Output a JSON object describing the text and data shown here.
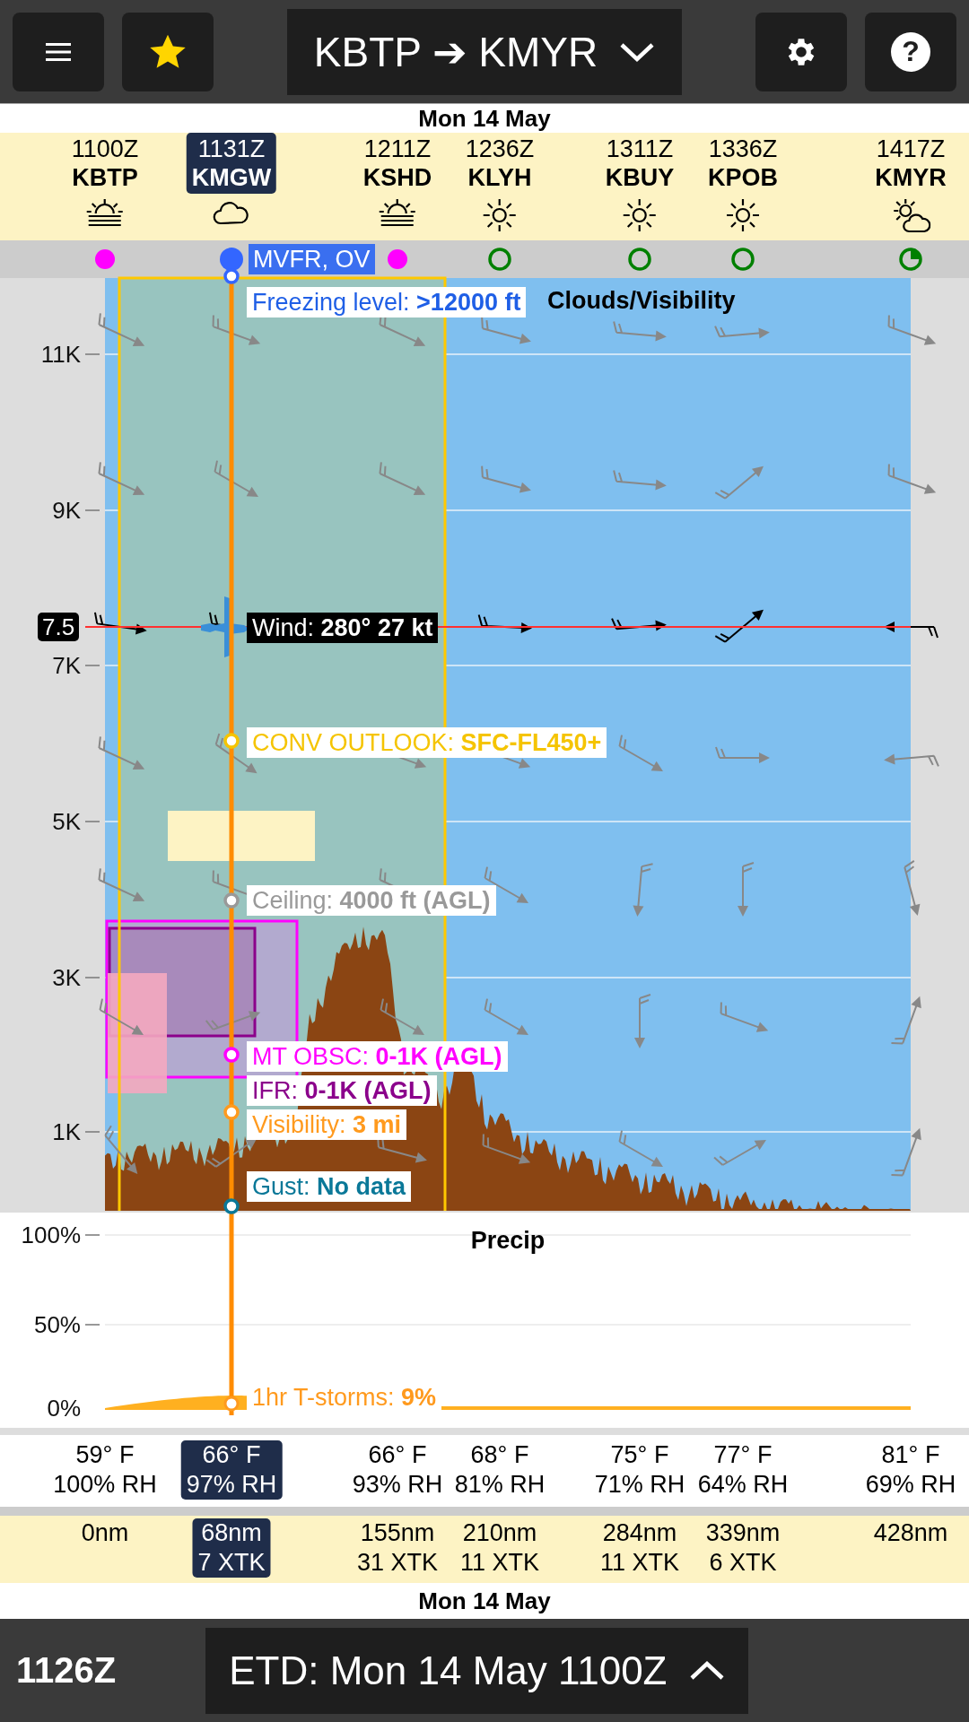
{
  "toolbar": {
    "left_buttons": [
      {
        "kind": "menu"
      },
      {
        "kind": "favorite"
      }
    ],
    "route": "KBTP ➔ KMYR",
    "right_buttons": [
      {
        "kind": "settings"
      },
      {
        "kind": "help",
        "label": "?"
      }
    ]
  },
  "date_top": "Mon 14 May",
  "stations": [
    {
      "time": "1100Z",
      "id": "KBTP",
      "weather_icon": {
        "kind": "haze"
      },
      "selected": false,
      "color": "#ff00ff",
      "kind": "filled"
    },
    {
      "time": "1131Z",
      "id": "KMGW",
      "weather_icon": {
        "kind": "cloud"
      },
      "selected": true,
      "color": "#3366ff",
      "kind": "filled"
    },
    {
      "time": "1211Z",
      "id": "KSHD",
      "weather_icon": {
        "kind": "haze"
      },
      "selected": false,
      "color": "#ff00ff",
      "kind": "filled"
    },
    {
      "time": "1236Z",
      "id": "KLYH",
      "weather_icon": {
        "kind": "sun"
      },
      "selected": false,
      "color": "#008000",
      "kind": "ring"
    },
    {
      "time": "1311Z",
      "id": "KBUY",
      "weather_icon": {
        "kind": "sun"
      },
      "selected": false,
      "color": "#008000",
      "kind": "ring"
    },
    {
      "time": "1336Z",
      "id": "KPOB",
      "weather_icon": {
        "kind": "sun"
      },
      "selected": false,
      "color": "#008000",
      "kind": "ring"
    },
    {
      "time": "1417Z",
      "id": "KMYR",
      "weather_icon": {
        "kind": "sun-cloud"
      },
      "selected": false,
      "color": "#008000",
      "kind": "pie"
    }
  ],
  "category_label": "MVFR, OV",
  "profile": {
    "title": "Clouds/Visibility",
    "y_labels": [
      "11K",
      "9K",
      "7K",
      "5K",
      "3K",
      "1K"
    ],
    "altitude": "7.5",
    "labels": [
      {
        "kind": "freezing",
        "text": "Freezing level: **>12000 ft**"
      },
      {
        "kind": "wind",
        "text": "Wind: **280° 27 kt**"
      },
      {
        "kind": "convective",
        "text": "CONV OUTLOOK: **SFC-FL450+**"
      },
      {
        "kind": "ceiling",
        "text": "Ceiling: **4000 ft (AGL)**"
      },
      {
        "kind": "mountain",
        "text": "MT OBSC: **0-1K (AGL)**"
      },
      {
        "kind": "ifr",
        "text": "IFR: **0-1K (AGL)**"
      },
      {
        "kind": "visibility",
        "text": "Visibility: **3 mi**"
      },
      {
        "kind": "gust",
        "text": "Gust: **No data**"
      }
    ]
  },
  "precip": {
    "title": "Precip",
    "y_labels": [
      "100%",
      "50%",
      "0%"
    ],
    "label": "1hr T-storms: **9%**"
  },
  "conditions": [
    {
      "temp": "59° F",
      "rh": "100% RH",
      "selected": false
    },
    {
      "temp": "66° F",
      "rh": "97% RH",
      "selected": true
    },
    {
      "temp": "66° F",
      "rh": "93% RH",
      "selected": false
    },
    {
      "temp": "68° F",
      "rh": "81% RH",
      "selected": false
    },
    {
      "temp": "75° F",
      "rh": "71% RH",
      "selected": false
    },
    {
      "temp": "77° F",
      "rh": "64% RH",
      "selected": false
    },
    {
      "temp": "81° F",
      "rh": "69% RH",
      "selected": false
    }
  ],
  "legs": [
    {
      "distance": "0nm",
      "selected": false
    },
    {
      "distance": "68nm",
      "xtk": "7 XTK",
      "selected": true
    },
    {
      "distance": "155nm",
      "xtk": "31 XTK",
      "selected": false
    },
    {
      "distance": "210nm",
      "xtk": "11 XTK",
      "selected": false
    },
    {
      "distance": "284nm",
      "xtk": "11 XTK",
      "selected": false
    },
    {
      "distance": "339nm",
      "xtk": "6 XTK",
      "selected": false
    },
    {
      "distance": "428nm",
      "selected": false
    }
  ],
  "date_bottom": "Mon 14 May",
  "clock": "1126Z",
  "etd": "ETD: Mon 14 May 1100Z"
}
